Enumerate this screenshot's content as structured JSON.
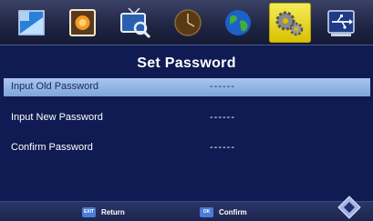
{
  "menu": {
    "tabs": [
      {
        "name": "picture",
        "icon": "picture-icon",
        "active": false
      },
      {
        "name": "photo",
        "icon": "photo-icon",
        "active": false
      },
      {
        "name": "channel-search",
        "icon": "tv-search-icon",
        "active": false
      },
      {
        "name": "clock",
        "icon": "clock-icon",
        "active": false
      },
      {
        "name": "globe",
        "icon": "globe-icon",
        "active": false
      },
      {
        "name": "settings",
        "icon": "gears-icon",
        "active": true
      },
      {
        "name": "usb",
        "icon": "usb-icon",
        "active": false
      }
    ]
  },
  "panel": {
    "title": "Set Password",
    "rows": [
      {
        "label": "Input Old Password",
        "value": "------",
        "selected": true
      },
      {
        "label": "Input New Password",
        "value": "------",
        "selected": false
      },
      {
        "label": "Confirm Password",
        "value": "------",
        "selected": false
      }
    ]
  },
  "footer": {
    "return_key": "EXIT",
    "return_label": "Return",
    "confirm_key": "OK",
    "confirm_label": "Confirm"
  },
  "colors": {
    "background": "#0f1b52",
    "selected_row": "#a9c5ee",
    "active_tab": "#f4ee5a",
    "key_badge": "#4a7cd8"
  }
}
